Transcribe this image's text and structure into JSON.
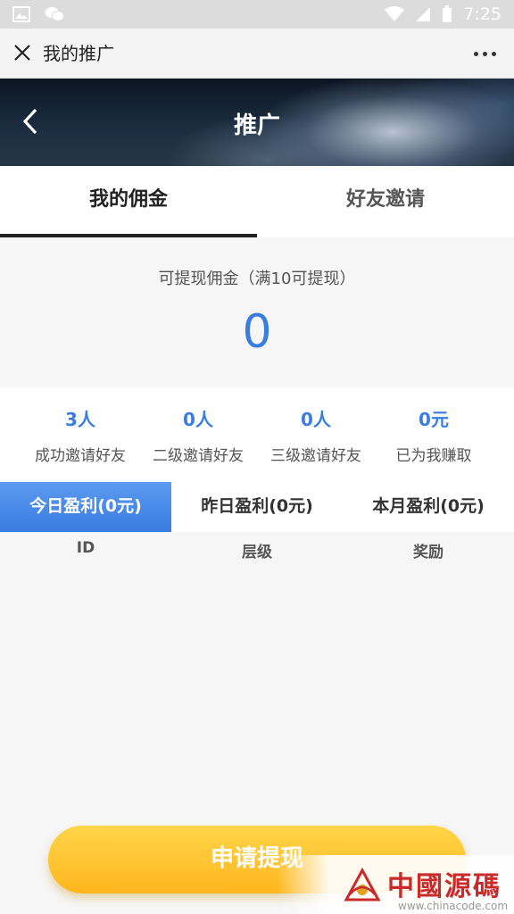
{
  "status_bar": {
    "time": "7:25"
  },
  "title_bar": {
    "title": "我的推广"
  },
  "header": {
    "title": "推广"
  },
  "tabs": [
    {
      "label": "我的佣金",
      "active": true
    },
    {
      "label": "好友邀请",
      "active": false
    }
  ],
  "balance": {
    "label": "可提现佣金（满10可提现）",
    "value": "0"
  },
  "stats": [
    {
      "value": "3人",
      "label": "成功邀请好友"
    },
    {
      "value": "0人",
      "label": "二级邀请好友"
    },
    {
      "value": "0人",
      "label": "三级邀请好友"
    },
    {
      "value": "0元",
      "label": "已为我赚取"
    }
  ],
  "profit_tabs": [
    {
      "label": "今日盈利(0元)",
      "active": true
    },
    {
      "label": "昨日盈利(0元)",
      "active": false
    },
    {
      "label": "本月盈利(0元)",
      "active": false
    }
  ],
  "table": {
    "columns": [
      "ID",
      "层级",
      "奖励"
    ],
    "rows": []
  },
  "withdraw_button": {
    "label": "申请提现"
  },
  "watermark": {
    "text": "中國源碼",
    "url": "www.chinacode.com"
  },
  "colors": {
    "accent": "#3a7de0",
    "button": "#ffc12a",
    "text": "#333333"
  }
}
